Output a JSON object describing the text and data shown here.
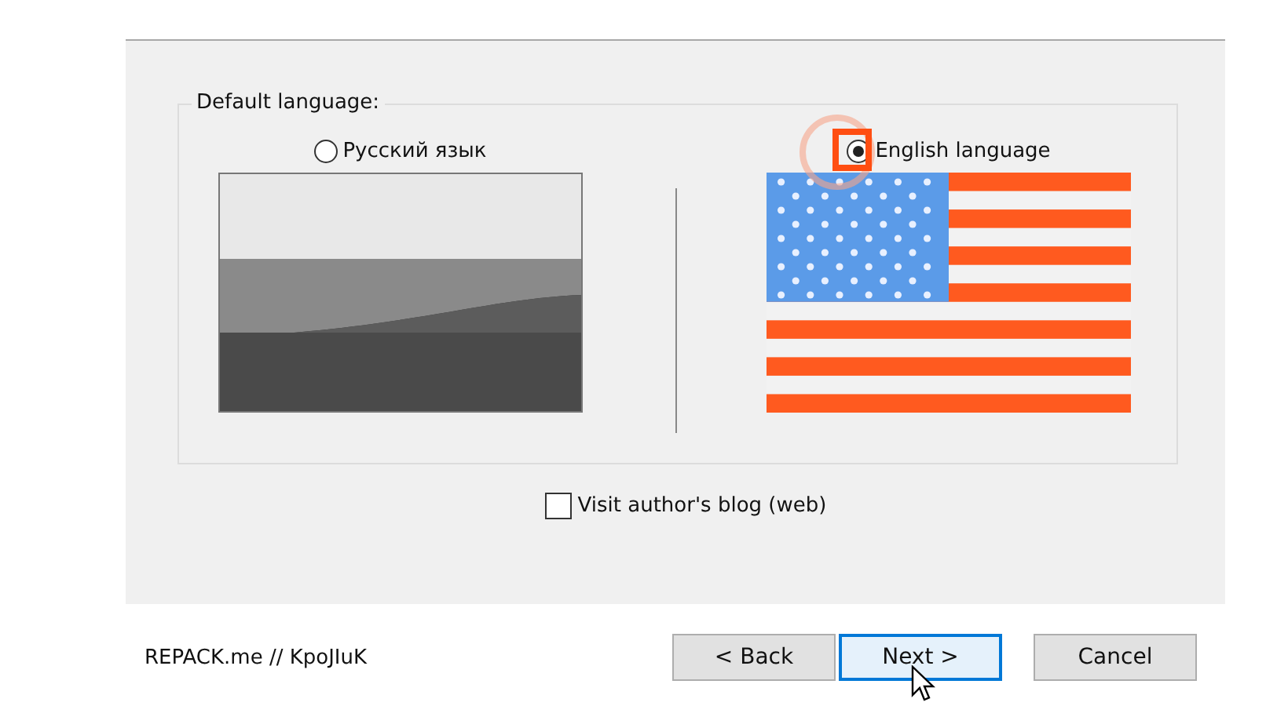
{
  "group": {
    "label": "Default language:",
    "options": [
      {
        "label": "Русский язык",
        "selected": false,
        "kind": "grey-flag"
      },
      {
        "label": "English language",
        "selected": true,
        "kind": "us-flag"
      }
    ]
  },
  "checkbox": {
    "label": "Visit author's blog (web)",
    "checked": false
  },
  "footer": {
    "credit": "REPACK.me // KpoJIuK"
  },
  "buttons": [
    {
      "label": "< Back",
      "focused": false
    },
    {
      "label": "Next >",
      "focused": true
    },
    {
      "label": "Cancel",
      "focused": false
    }
  ]
}
